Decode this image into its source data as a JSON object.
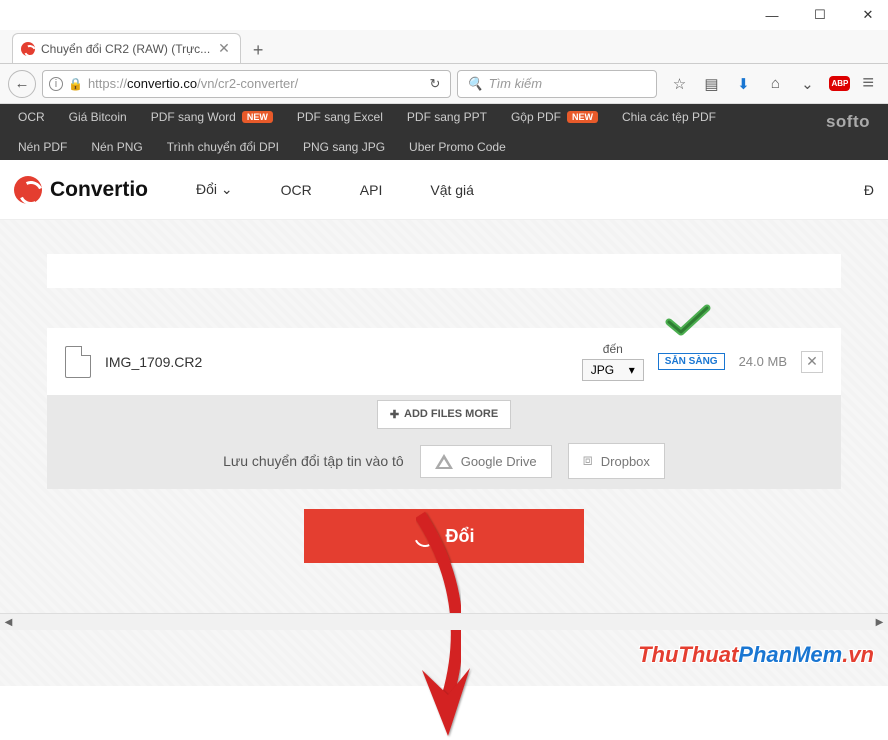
{
  "window": {
    "min": "—",
    "max": "☐",
    "close": "✕"
  },
  "tab": {
    "title": "Chuyển đổi CR2 (RAW) (Trực...",
    "close": "✕",
    "new": "+"
  },
  "urlbar": {
    "back": "←",
    "info": "i",
    "proto": "https://",
    "host": "convertio.co",
    "path": "/vn/cr2-converter/",
    "refresh": "↻",
    "search_icon": "🔍",
    "search_placeholder": "Tìm kiếm",
    "star": "☆",
    "books": "▤",
    "down": "⬇",
    "home": "⌂",
    "pocket": "⌄",
    "abp": "ABP",
    "menu": "≡"
  },
  "bookmarks": {
    "row1": [
      "OCR",
      "Giá Bitcoin",
      "PDF sang Word",
      "PDF sang Excel",
      "PDF sang PPT",
      "Gộp PDF",
      "Chia các tệp PDF"
    ],
    "row2": [
      "Nén PDF",
      "Nén PNG",
      "Trình chuyển đổi DPI",
      "PNG sang JPG",
      "Uber Promo Code"
    ],
    "new_badge": "NEW",
    "softo": "softo"
  },
  "site_nav": {
    "logo": "Convertio",
    "items": [
      "Đổi",
      "OCR",
      "API",
      "Vật giá"
    ],
    "right": "Đ"
  },
  "file": {
    "name": "IMG_1709.CR2",
    "to_label": "đến",
    "format": "JPG",
    "caret": "▾",
    "status": "SẴN SÀNG",
    "size": "24.0 MB",
    "remove": "✕"
  },
  "add_files": {
    "plus": "✚",
    "label": "ADD FILES MORE"
  },
  "save": {
    "label": "Lưu chuyển đổi tập tin vào tô",
    "gdrive": "Google Drive",
    "dropbox": "Dropbox",
    "db_icon": "⧈"
  },
  "convert": {
    "label": "Đổi"
  },
  "watermark": {
    "a": "ThuThuat",
    "b": "PhanMem",
    "c": ".vn"
  },
  "hscroll": {
    "l": "◀",
    "r": "▶"
  }
}
